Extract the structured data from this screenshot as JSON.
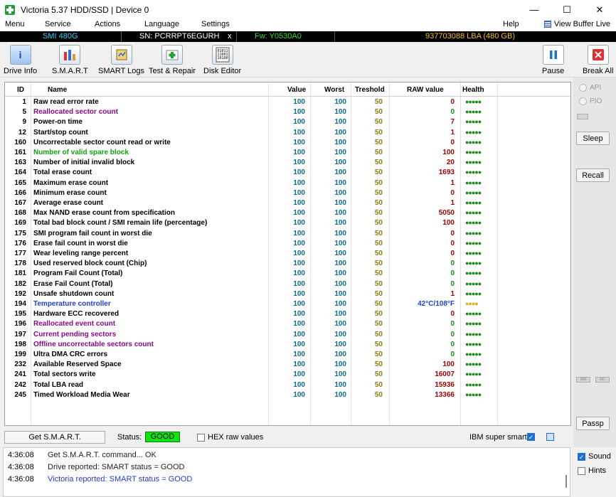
{
  "window": {
    "title": "Victoria 5.37 HDD/SSD | Device 0",
    "minimize": "—",
    "maximize": "☐",
    "close": "✕"
  },
  "menu": {
    "items": [
      "Menu",
      "Service",
      "Actions",
      "Language",
      "Settings",
      "Help"
    ],
    "view_buffer_live": "View Buffer Live"
  },
  "device_info": {
    "model": "SMI 480G",
    "serial": "SN: PCRRPT6EGURH",
    "x": "x",
    "firmware": "Fw: Y0530A0",
    "lba": "937703088 LBA (480 GB)"
  },
  "toolbar": {
    "drive_info": "Drive Info",
    "smart": "S.M.A.R.T",
    "smart_logs": "SMART Logs",
    "test_repair": "Test & Repair",
    "disk_editor": "Disk Editor",
    "pause": "Pause",
    "break_all": "Break All"
  },
  "table": {
    "headers": {
      "id": "ID",
      "name": "Name",
      "value": "Value",
      "worst": "Worst",
      "threshold": "Treshold",
      "raw": "RAW value",
      "health": "Health"
    },
    "rows": [
      {
        "id": "1",
        "name": "Raw read error rate",
        "value": "100",
        "worst": "100",
        "threshold": "50",
        "raw": "0",
        "health": "●●●●●",
        "name_color": "#000000",
        "raw_color": "#9b0000",
        "health_color": "#1a8a1a"
      },
      {
        "id": "5",
        "name": "Reallocated sector count",
        "value": "100",
        "worst": "100",
        "threshold": "50",
        "raw": "0",
        "health": "●●●●●",
        "name_color": "#8a0a8a",
        "raw_color": "#1a8a1a",
        "health_color": "#1a8a1a"
      },
      {
        "id": "9",
        "name": "Power-on time",
        "value": "100",
        "worst": "100",
        "threshold": "50",
        "raw": "7",
        "health": "●●●●●",
        "name_color": "#000000",
        "raw_color": "#9b0000",
        "health_color": "#1a8a1a"
      },
      {
        "id": "12",
        "name": "Start/stop count",
        "value": "100",
        "worst": "100",
        "threshold": "50",
        "raw": "1",
        "health": "●●●●●",
        "name_color": "#000000",
        "raw_color": "#9b0000",
        "health_color": "#1a8a1a"
      },
      {
        "id": "160",
        "name": "Uncorrectable sector count read or write",
        "value": "100",
        "worst": "100",
        "threshold": "50",
        "raw": "0",
        "health": "●●●●●",
        "name_color": "#000000",
        "raw_color": "#9b0000",
        "health_color": "#1a8a1a"
      },
      {
        "id": "161",
        "name": "Number of valid spare block",
        "value": "100",
        "worst": "100",
        "threshold": "50",
        "raw": "100",
        "health": "●●●●●",
        "name_color": "#12a012",
        "raw_color": "#9b0000",
        "health_color": "#1a8a1a"
      },
      {
        "id": "163",
        "name": "Number of initial invalid block",
        "value": "100",
        "worst": "100",
        "threshold": "50",
        "raw": "20",
        "health": "●●●●●",
        "name_color": "#000000",
        "raw_color": "#9b0000",
        "health_color": "#1a8a1a"
      },
      {
        "id": "164",
        "name": "Total erase count",
        "value": "100",
        "worst": "100",
        "threshold": "50",
        "raw": "1693",
        "health": "●●●●●",
        "name_color": "#000000",
        "raw_color": "#9b0000",
        "health_color": "#1a8a1a"
      },
      {
        "id": "165",
        "name": "Maximum erase count",
        "value": "100",
        "worst": "100",
        "threshold": "50",
        "raw": "1",
        "health": "●●●●●",
        "name_color": "#000000",
        "raw_color": "#9b0000",
        "health_color": "#1a8a1a"
      },
      {
        "id": "166",
        "name": "Minimum erase count",
        "value": "100",
        "worst": "100",
        "threshold": "50",
        "raw": "0",
        "health": "●●●●●",
        "name_color": "#000000",
        "raw_color": "#9b0000",
        "health_color": "#1a8a1a"
      },
      {
        "id": "167",
        "name": "Average erase count",
        "value": "100",
        "worst": "100",
        "threshold": "50",
        "raw": "1",
        "health": "●●●●●",
        "name_color": "#000000",
        "raw_color": "#9b0000",
        "health_color": "#1a8a1a"
      },
      {
        "id": "168",
        "name": "Max NAND erase count from specification",
        "value": "100",
        "worst": "100",
        "threshold": "50",
        "raw": "5050",
        "health": "●●●●●",
        "name_color": "#000000",
        "raw_color": "#9b0000",
        "health_color": "#1a8a1a"
      },
      {
        "id": "169",
        "name": "Total bad block count / SMI remain life (percentage)",
        "value": "100",
        "worst": "100",
        "threshold": "50",
        "raw": "100",
        "health": "●●●●●",
        "name_color": "#000000",
        "raw_color": "#9b0000",
        "health_color": "#1a8a1a"
      },
      {
        "id": "175",
        "name": "SMI program fail count in worst die",
        "value": "100",
        "worst": "100",
        "threshold": "50",
        "raw": "0",
        "health": "●●●●●",
        "name_color": "#000000",
        "raw_color": "#9b0000",
        "health_color": "#1a8a1a"
      },
      {
        "id": "176",
        "name": "Erase fail count in worst die",
        "value": "100",
        "worst": "100",
        "threshold": "50",
        "raw": "0",
        "health": "●●●●●",
        "name_color": "#000000",
        "raw_color": "#9b0000",
        "health_color": "#1a8a1a"
      },
      {
        "id": "177",
        "name": "Wear leveling range percent",
        "value": "100",
        "worst": "100",
        "threshold": "50",
        "raw": "0",
        "health": "●●●●●",
        "name_color": "#000000",
        "raw_color": "#9b0000",
        "health_color": "#1a8a1a"
      },
      {
        "id": "178",
        "name": "Used reserved block count (Chip)",
        "value": "100",
        "worst": "100",
        "threshold": "50",
        "raw": "0",
        "health": "●●●●●",
        "name_color": "#000000",
        "raw_color": "#1a8a1a",
        "health_color": "#1a8a1a"
      },
      {
        "id": "181",
        "name": "Program Fail Count (Total)",
        "value": "100",
        "worst": "100",
        "threshold": "50",
        "raw": "0",
        "health": "●●●●●",
        "name_color": "#000000",
        "raw_color": "#1a8a1a",
        "health_color": "#1a8a1a"
      },
      {
        "id": "182",
        "name": "Erase Fail Count (Total)",
        "value": "100",
        "worst": "100",
        "threshold": "50",
        "raw": "0",
        "health": "●●●●●",
        "name_color": "#000000",
        "raw_color": "#1a8a1a",
        "health_color": "#1a8a1a"
      },
      {
        "id": "192",
        "name": "Unsafe shutdown count",
        "value": "100",
        "worst": "100",
        "threshold": "50",
        "raw": "1",
        "health": "●●●●●",
        "name_color": "#000000",
        "raw_color": "#9b0000",
        "health_color": "#1a8a1a"
      },
      {
        "id": "194",
        "name": "Temperature controller",
        "value": "100",
        "worst": "100",
        "threshold": "50",
        "raw": "42°C/108°F",
        "health": "●●●●",
        "name_color": "#1f3fd0",
        "raw_color": "#1f3fd0",
        "health_color": "#e0b020"
      },
      {
        "id": "195",
        "name": "Hardware ECC recovered",
        "value": "100",
        "worst": "100",
        "threshold": "50",
        "raw": "0",
        "health": "●●●●●",
        "name_color": "#000000",
        "raw_color": "#9b0000",
        "health_color": "#1a8a1a"
      },
      {
        "id": "196",
        "name": "Reallocated event count",
        "value": "100",
        "worst": "100",
        "threshold": "50",
        "raw": "0",
        "health": "●●●●●",
        "name_color": "#8a0a8a",
        "raw_color": "#1a8a1a",
        "health_color": "#1a8a1a"
      },
      {
        "id": "197",
        "name": "Current pending sectors",
        "value": "100",
        "worst": "100",
        "threshold": "50",
        "raw": "0",
        "health": "●●●●●",
        "name_color": "#8a0a8a",
        "raw_color": "#1a8a1a",
        "health_color": "#1a8a1a"
      },
      {
        "id": "198",
        "name": "Offline uncorrectable sectors count",
        "value": "100",
        "worst": "100",
        "threshold": "50",
        "raw": "0",
        "health": "●●●●●",
        "name_color": "#8a0a8a",
        "raw_color": "#1a8a1a",
        "health_color": "#1a8a1a"
      },
      {
        "id": "199",
        "name": "Ultra DMA CRC errors",
        "value": "100",
        "worst": "100",
        "threshold": "50",
        "raw": "0",
        "health": "●●●●●",
        "name_color": "#000000",
        "raw_color": "#1a8a1a",
        "health_color": "#1a8a1a"
      },
      {
        "id": "232",
        "name": "Available Reserved Space",
        "value": "100",
        "worst": "100",
        "threshold": "50",
        "raw": "100",
        "health": "●●●●●",
        "name_color": "#000000",
        "raw_color": "#9b0000",
        "health_color": "#1a8a1a"
      },
      {
        "id": "241",
        "name": "Total sectors write",
        "value": "100",
        "worst": "100",
        "threshold": "50",
        "raw": "16007",
        "health": "●●●●●",
        "name_color": "#000000",
        "raw_color": "#9b0000",
        "health_color": "#1a8a1a"
      },
      {
        "id": "242",
        "name": "Total LBA read",
        "value": "100",
        "worst": "100",
        "threshold": "50",
        "raw": "15936",
        "health": "●●●●●",
        "name_color": "#000000",
        "raw_color": "#9b0000",
        "health_color": "#1a8a1a"
      },
      {
        "id": "245",
        "name": "Timed Workload Media Wear",
        "value": "100",
        "worst": "100",
        "threshold": "50",
        "raw": "13366",
        "health": "●●●●●",
        "name_color": "#000000",
        "raw_color": "#9b0000",
        "health_color": "#1a8a1a"
      }
    ]
  },
  "right_panel": {
    "api": "API",
    "pio": "PIO",
    "sleep": "Sleep",
    "recall": "Recall",
    "wr": "WR",
    "rd": "RD",
    "passp": "Passp",
    "sound": "Sound",
    "hints": "Hints"
  },
  "status": {
    "get_smart": "Get S.M.A.R.T.",
    "status_label": "Status:",
    "status_value": "GOOD",
    "hex_raw": "HEX raw values",
    "ibm_super_smart": "IBM super smart:"
  },
  "log": [
    {
      "time": "4:36:08",
      "text": "Get S.M.A.R.T. command... OK",
      "color": "#222222"
    },
    {
      "time": "4:36:08",
      "text": "Drive reported: SMART status = GOOD",
      "color": "#222222"
    },
    {
      "time": "4:36:08",
      "text": "Victoria reported: SMART status = GOOD",
      "color": "#1f3fd0"
    }
  ],
  "colors": {
    "status_good": "#11e211",
    "infobar_bg": "#000000",
    "model": "#2fd0ff",
    "serial": "#ffffff",
    "firmware": "#33dd33",
    "lba": "#f0c020"
  }
}
